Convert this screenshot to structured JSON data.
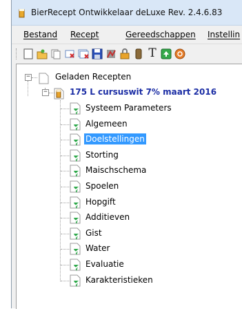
{
  "window": {
    "title": "BierRecept Ontwikkelaar deLuxe Rev. 2.4.6.83"
  },
  "menu": [
    "Bestand",
    "Recept",
    "Gereedschappen",
    "Instellin"
  ],
  "toolbar": {
    "buttons": [
      "new-doc-icon",
      "open-folder-icon",
      "copy-icon",
      "delete-icon",
      "delete-all-icon",
      "save-icon",
      "chart-icon",
      "lock-icon",
      "barrel-icon",
      "text-icon",
      "export-icon",
      "web-icon"
    ],
    "text_button_glyph": "T"
  },
  "tree": {
    "root_label": "Geladen Recepten",
    "recipe_label": "175 L cursuswit 7% maart 2016",
    "items": [
      "Systeem Parameters",
      "Algemeen",
      "Doelstellingen",
      "Storting",
      "Maischschema",
      "Spoelen",
      "Hopgift",
      "Additieven",
      "Gist",
      "Water",
      "Evaluatie",
      "Karakteristieken"
    ],
    "selected_item": "Doelstellingen"
  },
  "colors": {
    "selection": "#3399ff",
    "recipe_text": "#1c2ea5",
    "check_green": "#2ea84a"
  }
}
